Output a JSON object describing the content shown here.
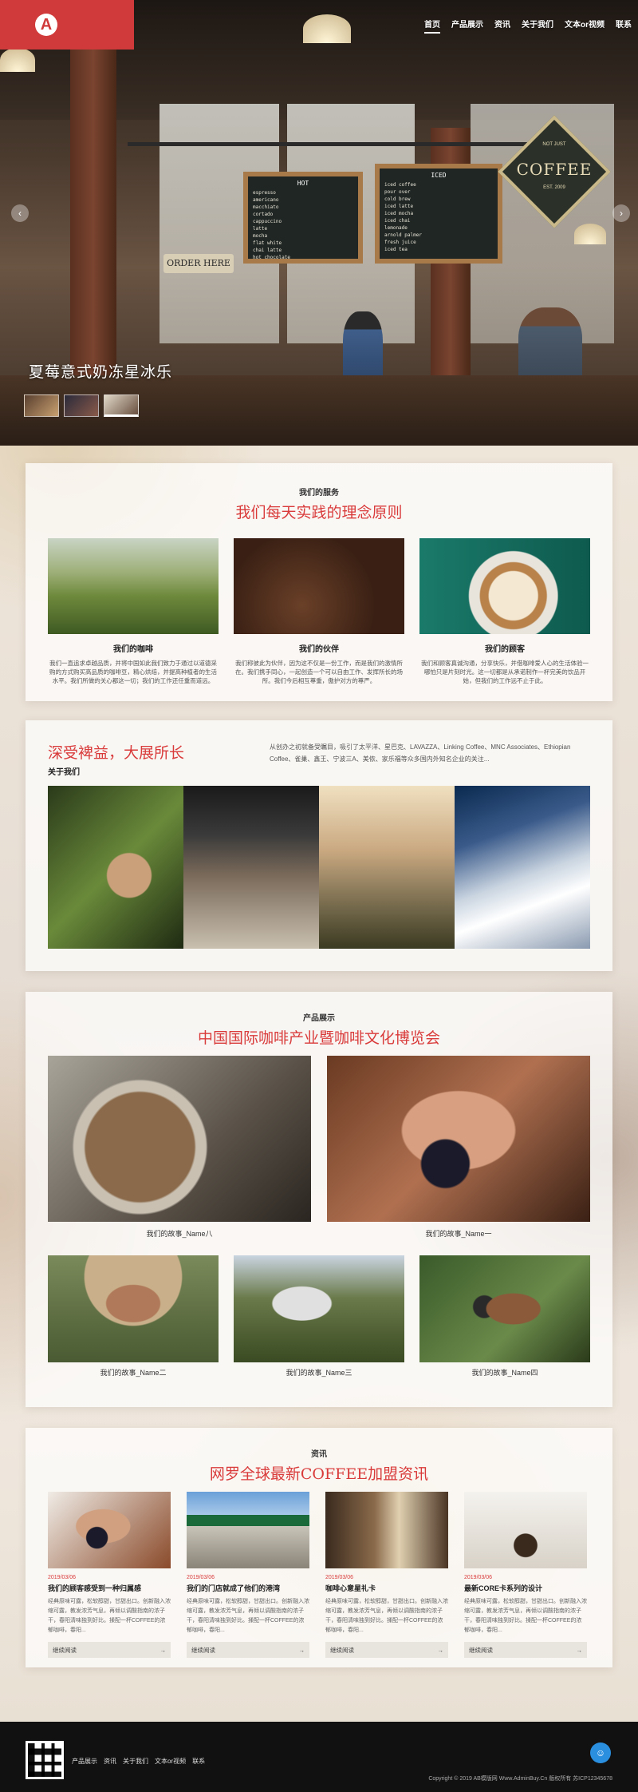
{
  "header": {
    "logo_letter": "A",
    "nav": [
      "首页",
      "产品展示",
      "资讯",
      "关于我们",
      "文本or视频",
      "联系"
    ]
  },
  "hero": {
    "caption": "夏莓意式奶冻星冰乐",
    "prev_icon": "‹",
    "next_icon": "›",
    "order_sign": "ORDER HERE",
    "coffee_sign": {
      "top": "NOT JUST",
      "main": "COFFEE",
      "bottom": "EST. 2009"
    },
    "board1": {
      "title": "HOT",
      "lines": [
        "espresso",
        "americano",
        "macchiato",
        "cortado",
        "cappuccino",
        "latte",
        "mocha",
        "flat white",
        "chai latte",
        "hot chocolate"
      ]
    },
    "board2": {
      "title": "ICED",
      "lines": [
        "iced coffee",
        "pour over",
        "cold brew",
        "iced latte",
        "iced mocha",
        "iced chai",
        "lemonade",
        "arnold palmer",
        "fresh juice",
        "iced tea"
      ]
    }
  },
  "services": {
    "kicker": "我们的服务",
    "title": "我们每天实践的理念原则",
    "items": [
      {
        "name": "我们的咖啡",
        "desc": "我们一直追求卓越品质，并将中国如此我们致力于通过以道德采购的方式购买高品质的咖啡豆，精心烘焙，并提高种植者的生活水平。我们所做的关心都这一切；我们的工作还任重而道远。"
      },
      {
        "name": "我们的伙伴",
        "desc": "我们称彼此为伙伴，因为这不仅是一份工作，而是我们的激情所在。我们携手同心，一起创造一个可以自由工作、发挥所长的场所。我们今后相互尊重，傲护对方的尊严。"
      },
      {
        "name": "我们的顾客",
        "desc": "我们和顾客真诚沟通，分享快乐，并借咖啡爱人心的生活体验一哪怕只是片刻时光。这一切都是从承诺制作一杯完美的饮品开始，但我们的工作远不止于此。"
      }
    ]
  },
  "about": {
    "title": "深受裨益，大展所长",
    "subtitle": "关于我们",
    "text": "从创办之初就备受瞩目，吸引了太平洋、星巴克、LAVAZZA、Linking Coffee、MNC Associates、Ethiopian Coffee、雀巢、鑫王、宁波三A、美侬、家乐福等众多国内外知名企业的关注..."
  },
  "products": {
    "kicker": "产品展示",
    "title": "中国国际咖啡产业暨咖啡文化博览会",
    "items": [
      "我们的故事_Name八",
      "我们的故事_Name一",
      "我们的故事_Name二",
      "我们的故事_Name三",
      "我们的故事_Name四"
    ]
  },
  "news": {
    "kicker": "资讯",
    "title": "网罗全球最新COFFEE加盟资讯",
    "items": [
      {
        "date": "2019/03/06",
        "title": "我们的顾客感受到一种归属感",
        "desc": "经典原味可露，松软醇甜，甘甜出口。创新融入浓缩可露，教发浓芳气息，再倾以调酸指南的浓子干，春阳清味独到好比。揉配一杯COFFEE的浓郁咖啡，春阳...",
        "more": "继续阅读"
      },
      {
        "date": "2019/03/06",
        "title": "我们的门店就成了他们的港湾",
        "desc": "经典原味可露，松软醇甜，甘甜出口。创新融入浓缩可露，教发浓芳气息，再倾以调酸指南的浓子干，春阳清味独到好比。揉配一杯COFFEE的浓郁咖啡，春阳...",
        "more": "继续阅读"
      },
      {
        "date": "2019/03/06",
        "title": "咖啡心意星礼卡",
        "desc": "经典原味可露，松软醇甜，甘甜出口。创新融入浓缩可露，教发浓芳气息，再倾以调酸指南的浓子干，春阳清味独到好比。揉配一杯COFFEE的浓郁咖啡，春阳...",
        "more": "继续阅读"
      },
      {
        "date": "2019/03/06",
        "title": "最新CORE卡系列的设计",
        "desc": "经典原味可露，松软醇甜，甘甜出口。创新融入浓缩可露，教发浓芳气息，再倾以调酸指南的浓子干，春阳清味独到好比。揉配一杯COFFEE的浓郁咖啡，春阳...",
        "more": "继续阅读"
      }
    ],
    "arrow": "→"
  },
  "footer": {
    "links": [
      "产品展示",
      "资讯",
      "关于我们",
      "文本or视频",
      "联系"
    ],
    "copyright": "Copyright © 2019 AB模版网 Www.AdminBuy.Cn 版权所有   苏ICP12345678",
    "chat_icon": "☺"
  },
  "colors": {
    "accent": "#d93b3b",
    "logo_bg": "#d03a3a",
    "footer_bg": "#111111",
    "chat": "#2b8fe0"
  }
}
